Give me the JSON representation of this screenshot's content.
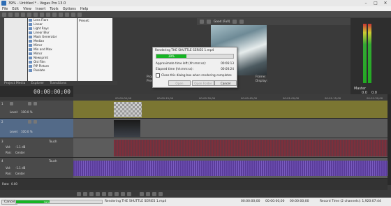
{
  "window": {
    "title": "39% - Untitled * - Vegas Pro 13.0",
    "buttons": [
      "–",
      "□",
      "✕"
    ]
  },
  "menu": [
    "File",
    "Edit",
    "View",
    "Insert",
    "Tools",
    "Options",
    "Help"
  ],
  "explorer": {
    "fx_items": [
      "Lens Flare",
      "Linear",
      "Light Rays",
      "Linear Blur",
      "Mask Generator",
      "Median",
      "Mirror",
      "Min and Max",
      "Mirror",
      "Newsprint",
      "Old Film",
      "PIP Picture",
      "Pixelate"
    ],
    "presets_label": "Preset:",
    "tabs": [
      "Project Media",
      "Explorer",
      "Transitions"
    ]
  },
  "preview": {
    "mode_label": "Good (Full)",
    "project_label": "Project:",
    "project_value": "1280x720x32, 29.970i",
    "preview_label": "Preview:",
    "preview_value": "320x180x32, 29.970p",
    "frame_label": "Frame:",
    "frame_value": "229",
    "display_label": "Display:",
    "display_value": "229x128x32"
  },
  "timecode": "00:00:00;00",
  "ruler": [
    "00:00:00;00",
    "00:00:15;00",
    "00:00:30;00",
    "00:00:45;00",
    "00:01:00;00",
    "00:01:15;00",
    "00:01:30;00",
    "00:01:45;00"
  ],
  "tracks": [
    {
      "num": "1",
      "level_label": "Level:",
      "level": "100.0 %"
    },
    {
      "num": "2",
      "level_label": "Level:",
      "level": "100.0 %"
    },
    {
      "num": "3",
      "vol_label": "Vol:",
      "vol": "-1.1 dB",
      "pan_label": "Pan:",
      "pan": "Center",
      "touch": "Touch"
    },
    {
      "num": "4",
      "vol_label": "Vol:",
      "vol": "-1.1 dB",
      "pan_label": "Pan:",
      "pan": "Center",
      "touch": "Touch"
    }
  ],
  "dialog": {
    "title": "Rendering THE SHUTTLE SERIES 1.mp4",
    "progress_percent": 39,
    "progress_label": "39%",
    "approx_label": "Approximate time left (hh:mm:ss):",
    "approx_value": "00:06:13",
    "elapsed_label": "Elapsed time (hh:mm:ss):",
    "elapsed_value": "00:00:24",
    "checkbox_label": "Close this dialog box when rendering completes",
    "buttons": [
      "Open",
      "Open Folder",
      "Cancel"
    ]
  },
  "rate": {
    "label": "Rate:",
    "value": "0.00"
  },
  "status": {
    "cancel": "Cancel",
    "percent": "39%",
    "message": "Rendering THE SHUTTLE SERIES 1.mp4",
    "times": [
      "00:00:00;00",
      "00:00:00;00",
      "00:00:00;00"
    ],
    "record_time": "Record Time (2 channels): 1,920:07:44"
  },
  "mixer": {
    "master": "Master",
    "values": [
      "0.0",
      "0.0"
    ]
  }
}
